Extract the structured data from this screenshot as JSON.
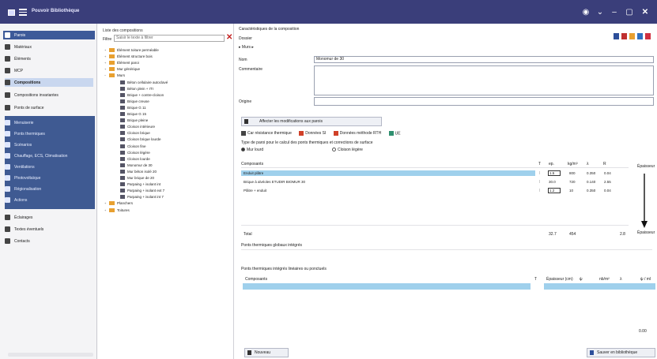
{
  "window": {
    "title": "Pouvoir Bibliothèque"
  },
  "sidebar": {
    "items": [
      {
        "label": "Parois"
      },
      {
        "label": "Matériaux"
      },
      {
        "label": "Éléments"
      },
      {
        "label": "MCP"
      },
      {
        "label": "Compositions"
      },
      {
        "label": "Compositions invariantes"
      },
      {
        "label": "Ponts de surface"
      }
    ],
    "group": [
      {
        "label": "Menuiserie"
      },
      {
        "label": "Ponts thermiques"
      },
      {
        "label": "Scénarios"
      },
      {
        "label": "Chauffage, ECS, Climatisation"
      },
      {
        "label": "Ventilations"
      },
      {
        "label": "Photovoltaïque"
      },
      {
        "label": "Régionalisation"
      },
      {
        "label": "Actions"
      }
    ],
    "bottom": [
      {
        "label": "Éclairages"
      },
      {
        "label": "Textes éventuels"
      },
      {
        "label": "Contacts"
      }
    ]
  },
  "library": {
    "title": "Liste des compositions",
    "filter_label": "Filtre",
    "filter_value": "Saisir le texte à filtrer",
    "tree": [
      {
        "label": "Élément toiture perméable",
        "level": 1,
        "type": "folder",
        "exp": "+"
      },
      {
        "label": "Élément structure bois",
        "level": 1,
        "type": "folder",
        "exp": "+"
      },
      {
        "label": "Élément paroi",
        "level": 1,
        "type": "folder",
        "exp": "+"
      },
      {
        "label": "Mur générique",
        "level": 1,
        "type": "folder",
        "exp": "+"
      },
      {
        "label": "Murs",
        "level": 1,
        "type": "folder",
        "exp": "−"
      },
      {
        "label": "Béton cellulaire autoclavé",
        "level": 2,
        "type": "leaf"
      },
      {
        "label": "Béton plein + ITI",
        "level": 2,
        "type": "leaf"
      },
      {
        "label": "Brique + contre-cloison",
        "level": 2,
        "type": "leaf"
      },
      {
        "label": "Brique creuse",
        "level": 2,
        "type": "leaf"
      },
      {
        "label": "Brique G 11",
        "level": 2,
        "type": "leaf"
      },
      {
        "label": "Brique G 15",
        "level": 2,
        "type": "leaf"
      },
      {
        "label": "Brique pleine",
        "level": 2,
        "type": "leaf"
      },
      {
        "label": "Cloison intérieure",
        "level": 2,
        "type": "leaf"
      },
      {
        "label": "Cloison brique",
        "level": 2,
        "type": "leaf"
      },
      {
        "label": "Cloison brique lourde",
        "level": 2,
        "type": "leaf"
      },
      {
        "label": "Cloison fine",
        "level": 2,
        "type": "leaf"
      },
      {
        "label": "Cloison légère",
        "level": 2,
        "type": "leaf"
      },
      {
        "label": "Cloison lourde",
        "level": 2,
        "type": "leaf"
      },
      {
        "label": "Monomur de 30",
        "level": 2,
        "type": "leaf"
      },
      {
        "label": "Mur béton isolé 20",
        "level": 2,
        "type": "leaf"
      },
      {
        "label": "Mur brique de 20",
        "level": 2,
        "type": "leaf"
      },
      {
        "label": "Parpaing + isolant int",
        "level": 2,
        "type": "leaf"
      },
      {
        "label": "Parpaing + isolant ext 7",
        "level": 2,
        "type": "leaf"
      },
      {
        "label": "Parpaing + isolant int 7",
        "level": 2,
        "type": "leaf"
      },
      {
        "label": "Planchers",
        "level": 1,
        "type": "folder",
        "exp": "+"
      },
      {
        "label": "Toitures",
        "level": 1,
        "type": "folder",
        "exp": "+"
      }
    ]
  },
  "main": {
    "heading": "Caractéristiques de la composition",
    "dossier_label": "Dossier",
    "dossier_path": "▸ Murs ▸",
    "nom_label": "Nom",
    "nom_value": "Monomur de 30",
    "commentaire_label": "Commentaire",
    "commentaire_value": "",
    "origine_label": "Origine",
    "origine_value": "",
    "apply_button": "Affecter les modifications aux parois",
    "options": {
      "opt1": "Car résistance thermique",
      "opt2": "Données SI",
      "opt3": "Données méthode RTH",
      "opt4": "UE"
    },
    "type_text": "Type de paroi pour le calcul des ponts thermiques et corrections de surface",
    "radio1": "Mur lourd",
    "radio2": "Cloison légère",
    "table": {
      "headers": [
        "Composants",
        "T",
        "ep.",
        "kg/m³",
        "λ",
        "R",
        "Épaisseur"
      ],
      "rows": [
        {
          "name": "Enduit plâtre",
          "ep": "1.5",
          "kg": "800",
          "lam": "0.350",
          "r": "0.04",
          "box": true
        },
        {
          "name": "Brique à alvéoles ETUDIR BIOMUR 30",
          "ep": "30.0",
          "kg": "720",
          "lam": "0.140",
          "r": "2.55",
          "box": false
        },
        {
          "name": "Plâtre + enduit",
          "ep": "1.2",
          "kg": "10",
          "lam": "0.350",
          "r": "0.04",
          "box": true
        }
      ],
      "total_label": "Total",
      "total_ep": "32.7",
      "total_kg": "454",
      "total_r": "2.8",
      "right_label": "Épaisseur"
    },
    "pont_line": "Ponts thermiques globaux intégrés",
    "pont2_title": "Ponts thermiques intégrés linéaires ou ponctuels",
    "bottom_table": {
      "headers": [
        "Composants",
        "T",
        "Épaisseur (cm)",
        "ψ",
        "nb/m²",
        "λ",
        "ψ / ml"
      ]
    },
    "bottom_value": "0.00",
    "btn_nouveau": "Nouveau",
    "btn_save": "Sauver en bibliothèque"
  }
}
